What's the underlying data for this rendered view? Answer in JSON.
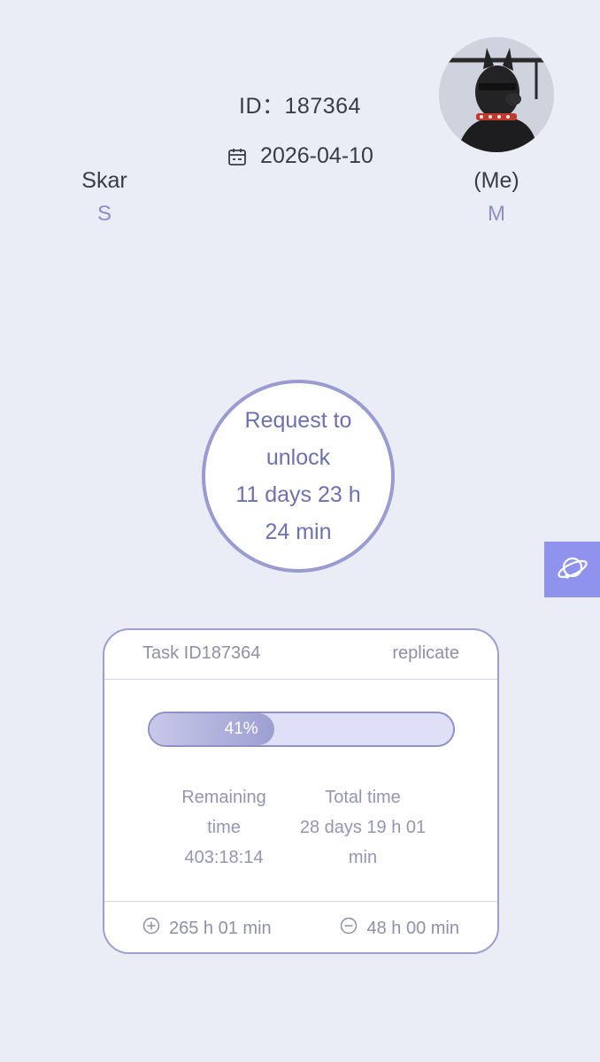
{
  "header": {
    "id_label": "ID：",
    "id_value": "187364",
    "date": "2026-04-10"
  },
  "users": {
    "left": {
      "name": "Skar",
      "role": "S"
    },
    "right": {
      "name": "(Me)",
      "role": "M"
    }
  },
  "unlock": {
    "line1": "Request to",
    "line2": "unlock",
    "line3": "11 days 23 h",
    "line4": "24 min"
  },
  "task": {
    "task_id": "Task ID187364",
    "replicate_label": "replicate",
    "progress_percent": 41,
    "progress_label": "41%",
    "remaining_line1": "Remaining",
    "remaining_line2": "time",
    "remaining_value": "403:18:14",
    "total_label": "Total time",
    "total_line1": "28 days 19 h 01",
    "total_line2": "min",
    "add_time": "265 h 01 min",
    "subtract_time": "48 h 00 min"
  },
  "colors": {
    "background": "#eaecf6",
    "accent": "#8f93ee",
    "circle_border": "#9a9bd0",
    "role_text": "#8d8fc7"
  },
  "icons": {
    "date": "calendar-icon",
    "float": "orbit-icon",
    "add": "plus-circle-icon",
    "subtract": "minus-circle-icon"
  }
}
